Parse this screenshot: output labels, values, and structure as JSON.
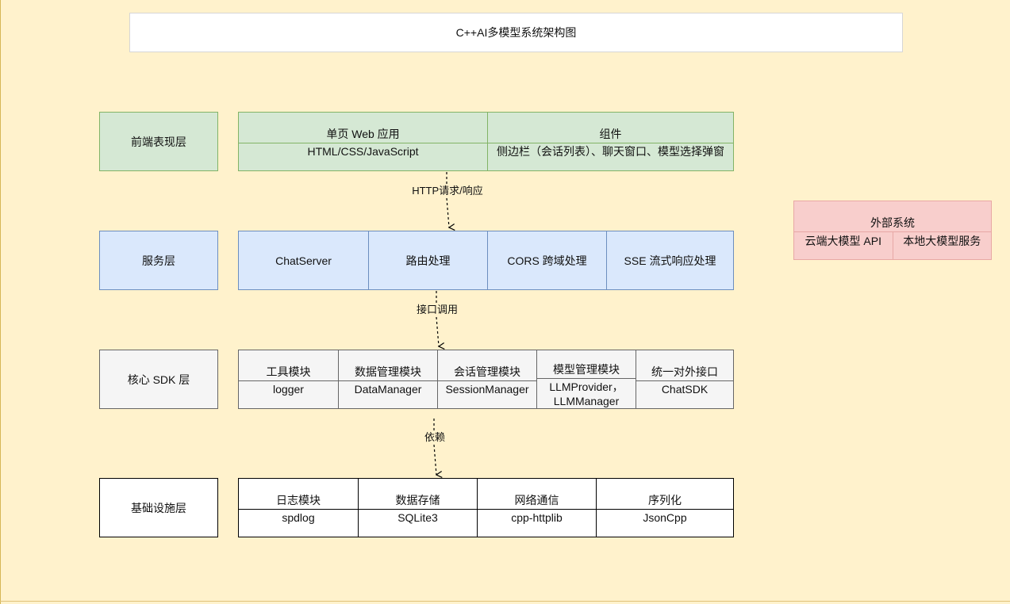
{
  "title": "C++AI多模型系统架构图",
  "layers": {
    "frontend": {
      "label": "前端表现层",
      "cells": [
        {
          "name": "单页 Web 应用",
          "detail": "HTML/CSS/JavaScript"
        },
        {
          "name": "组件",
          "detail": "侧边栏（会话列表）、聊天窗口、模型选择弹窗"
        }
      ]
    },
    "service": {
      "label": "服务层",
      "cells": [
        "ChatServer",
        "路由处理",
        "CORS 跨域处理",
        "SSE 流式响应处理"
      ]
    },
    "core": {
      "label": "核心 SDK 层",
      "cells": [
        {
          "name": "工具模块",
          "detail": "logger"
        },
        {
          "name": "数据管理模块",
          "detail": "DataManager"
        },
        {
          "name": "会话管理模块",
          "detail": "SessionManager"
        },
        {
          "name": "模型管理模块",
          "detail": "LLMProvider，LLMManager"
        },
        {
          "name": "统一对外接口",
          "detail": "ChatSDK"
        }
      ]
    },
    "infra": {
      "label": "基础设施层",
      "cells": [
        {
          "name": "日志模块",
          "detail": "spdlog"
        },
        {
          "name": "数据存储",
          "detail": "SQLite3"
        },
        {
          "name": "网络通信",
          "detail": "cpp-httplib"
        },
        {
          "name": "序列化",
          "detail": "JsonCpp"
        }
      ]
    }
  },
  "external": {
    "title": "外部系统",
    "items": [
      "云端大模型 API",
      "本地大模型服务"
    ]
  },
  "edges": [
    {
      "label": "HTTP请求/响应"
    },
    {
      "label": "接口调用"
    },
    {
      "label": "依赖"
    }
  ]
}
